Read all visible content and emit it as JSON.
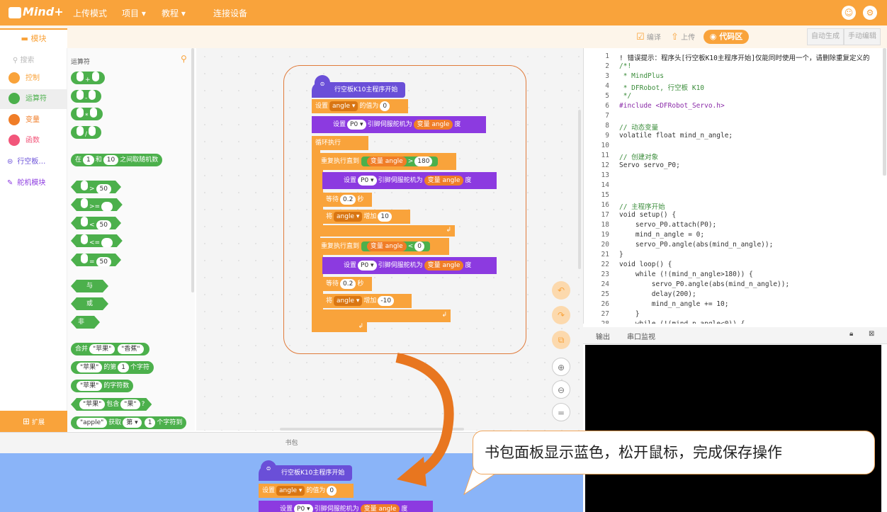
{
  "topbar": {
    "logo": "Mind+",
    "menu": [
      "上传模式",
      "项目",
      "教程",
      "连接设备"
    ]
  },
  "toolbar": {
    "modules_tab": "模块",
    "compile": "编译",
    "upload": "上传",
    "code_area": "代码区",
    "auto_gen": "自动生成",
    "manual_edit": "手动编辑"
  },
  "categories": {
    "search_placeholder": "搜索",
    "items": [
      {
        "label": "控制",
        "color": "#f9a33b"
      },
      {
        "label": "运算符",
        "color": "#4cb04c"
      },
      {
        "label": "变量",
        "color": "#f07d27"
      },
      {
        "label": "函数",
        "color": "#f2567a"
      },
      {
        "label": "行空板…",
        "color": "#6a4fd8"
      },
      {
        "label": "舵机模块",
        "color": "#8c3ae0"
      }
    ],
    "extension": "扩展"
  },
  "palette": {
    "title": "运算符",
    "arith": [
      "+",
      "-",
      "*",
      "/"
    ],
    "random": {
      "pre": "在",
      "a": "1",
      "mid": "和",
      "b": "10",
      "post": "之间取随机数"
    },
    "compare": [
      {
        "op": ">",
        "val": "50"
      },
      {
        "op": ">=",
        "val": ""
      },
      {
        "op": "<",
        "val": "50"
      },
      {
        "op": "<=",
        "val": ""
      },
      {
        "op": "=",
        "val": "50"
      }
    ],
    "logic": [
      "与",
      "或",
      "非"
    ],
    "strings": {
      "join": "合并",
      "apple": "\"苹果\"",
      "banana": "\"香蕉\"",
      "of": "的第",
      "one": "1",
      "char": "个字符",
      "length": "的字符数",
      "contains": "包含",
      "fruit": "\"果\"",
      "q": "?",
      "apple_en": "\"apple\"",
      "get": "获取",
      "nth": "第",
      "chars_to": "个字符到"
    }
  },
  "script": {
    "hat": "行空板K10主程序开始",
    "set": "设置",
    "var_angle": "angle",
    "value_of": "的值为",
    "zero": "0",
    "pin": "P0",
    "servo_to": "引脚伺服舵机为",
    "var_label": "变量 angle",
    "degree": "度",
    "loop": "循环执行",
    "repeat_until": "重复执行直到",
    "gt": ">",
    "v180": "180",
    "wait": "等待",
    "v02": "0.2",
    "sec": "秒",
    "take": "将",
    "inc": "增加",
    "v10": "10",
    "lt": "<",
    "v0": "0",
    "vm10": "-10"
  },
  "code": {
    "lines": [
      {
        "n": "1",
        "t": "! 错误提示：程序头[行空板K10主程序开始]仅能同时使用一个，请删除重复定义的"
      },
      {
        "n": "2",
        "t": "/*!"
      },
      {
        "n": "3",
        "t": " * MindPlus"
      },
      {
        "n": "4",
        "t": " * DFRobot, 行空板 K10"
      },
      {
        "n": "5",
        "t": " */"
      },
      {
        "n": "6",
        "t": "#include <DFRobot_Servo.h>"
      },
      {
        "n": "7",
        "t": ""
      },
      {
        "n": "8",
        "t": "// 动态变量"
      },
      {
        "n": "9",
        "t": "volatile float mind_n_angle;"
      },
      {
        "n": "10",
        "t": ""
      },
      {
        "n": "11",
        "t": "// 创建对象"
      },
      {
        "n": "12",
        "t": "Servo servo_P0;"
      },
      {
        "n": "13",
        "t": ""
      },
      {
        "n": "14",
        "t": ""
      },
      {
        "n": "15",
        "t": ""
      },
      {
        "n": "16",
        "t": "// 主程序开始"
      },
      {
        "n": "17",
        "t": "void setup() {"
      },
      {
        "n": "18",
        "t": "    servo_P0.attach(P0);"
      },
      {
        "n": "19",
        "t": "    mind_n_angle = 0;"
      },
      {
        "n": "20",
        "t": "    servo_P0.angle(abs(mind_n_angle));"
      },
      {
        "n": "21",
        "t": "}"
      },
      {
        "n": "22",
        "t": "void loop() {"
      },
      {
        "n": "23",
        "t": "    while (!(mind_n_angle>180)) {"
      },
      {
        "n": "24",
        "t": "        servo_P0.angle(abs(mind_n_angle));"
      },
      {
        "n": "25",
        "t": "        delay(200);"
      },
      {
        "n": "26",
        "t": "        mind_n_angle += 10;"
      },
      {
        "n": "27",
        "t": "    }"
      },
      {
        "n": "28",
        "t": "    while (!(mind_n_angle<0)) {"
      }
    ]
  },
  "output": {
    "tab_output": "输出",
    "tab_serial": "串口监视"
  },
  "bag": {
    "label": "书包"
  },
  "callout": "书包面板显示蓝色，松开鼠标，完成保存操作"
}
